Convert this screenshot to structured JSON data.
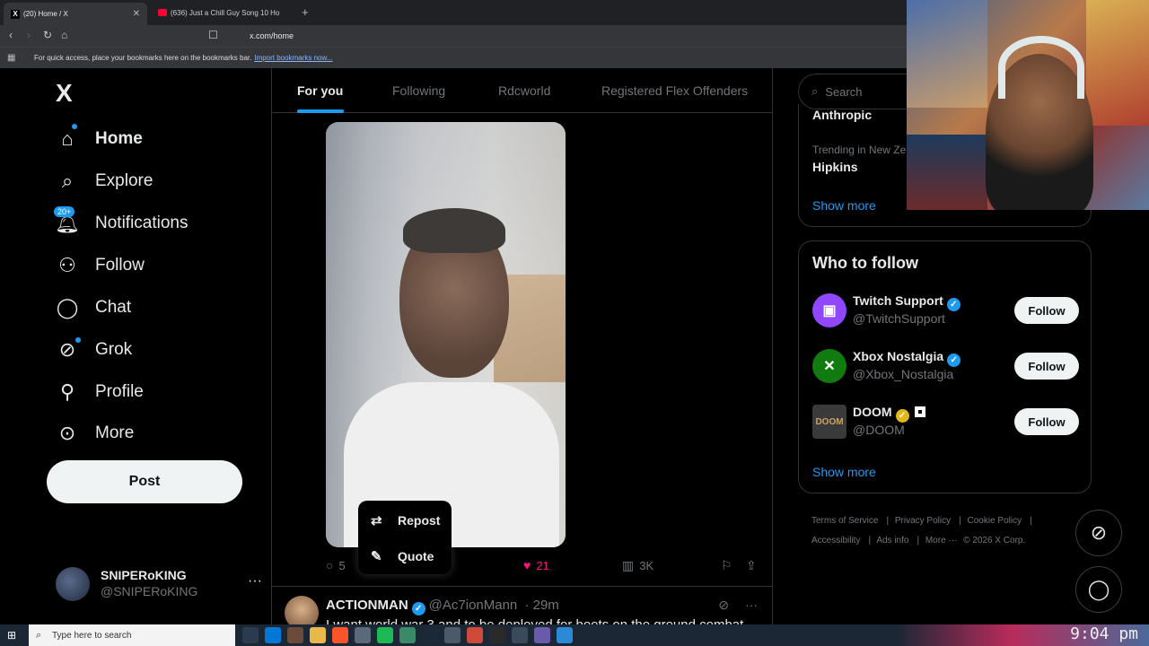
{
  "browser": {
    "tabs": [
      {
        "label": "(20) Home / X"
      },
      {
        "label": "(636) Just a Chill Guy Song 10 Ho"
      }
    ],
    "url": "x.com/home",
    "bookmarks_hint": "For quick access, place your bookmarks here on the bookmarks bar.",
    "import_link": "Import bookmarks now..."
  },
  "nav": {
    "logo": "X",
    "notifications_badge": "20+",
    "items": [
      {
        "label": "Home",
        "icon": "home-icon"
      },
      {
        "label": "Explore",
        "icon": "search-icon"
      },
      {
        "label": "Notifications",
        "icon": "bell-icon"
      },
      {
        "label": "Follow",
        "icon": "person-add-icon"
      },
      {
        "label": "Chat",
        "icon": "chat-icon"
      },
      {
        "label": "Grok",
        "icon": "grok-icon"
      },
      {
        "label": "Profile",
        "icon": "person-icon"
      },
      {
        "label": "More",
        "icon": "more-circle-icon"
      }
    ],
    "post_label": "Post",
    "account": {
      "name": "SNIPERoKING",
      "handle": "@SNIPERoKING"
    }
  },
  "feed": {
    "tabs": [
      "For you",
      "Following",
      "Rdcworld",
      "Registered Flex Offenders"
    ],
    "menu": {
      "repost": "Repost",
      "quote": "Quote"
    },
    "actions": {
      "replies": "5",
      "likes": "21",
      "views": "3K"
    },
    "next_post": {
      "name": "ACTIONMAN",
      "handle": "@Ac7ionMann",
      "time": "· 29m",
      "text": "I want world war 3 and to be deployed for boots on the ground combat"
    }
  },
  "sidebar": {
    "search_placeholder": "Search",
    "trend_prev": "Anthropic",
    "trend_context": "Trending in New Ze",
    "trend_name": "Hipkins",
    "show_more": "Show more",
    "who_to_follow": "Who to follow",
    "follow_label": "Follow",
    "suggestions": [
      {
        "name": "Twitch Support",
        "handle": "@TwitchSupport",
        "color": "#9146ff"
      },
      {
        "name": "Xbox Nostalgia",
        "handle": "@Xbox_Nostalgia",
        "color": "#107c10"
      },
      {
        "name": "DOOM",
        "handle": "@DOOM",
        "color": "#3a3a3a"
      }
    ],
    "footer": [
      "Terms of Service",
      "Privacy Policy",
      "Cookie Policy",
      "Accessibility",
      "Ads info",
      "More ···",
      "© 2026 X Corp."
    ]
  },
  "taskbar": {
    "search_placeholder": "Type here to search",
    "clock": "9:04 pm"
  },
  "colors": {
    "accent": "#1d9bf0",
    "like": "#f91880",
    "bg": "#000000"
  }
}
